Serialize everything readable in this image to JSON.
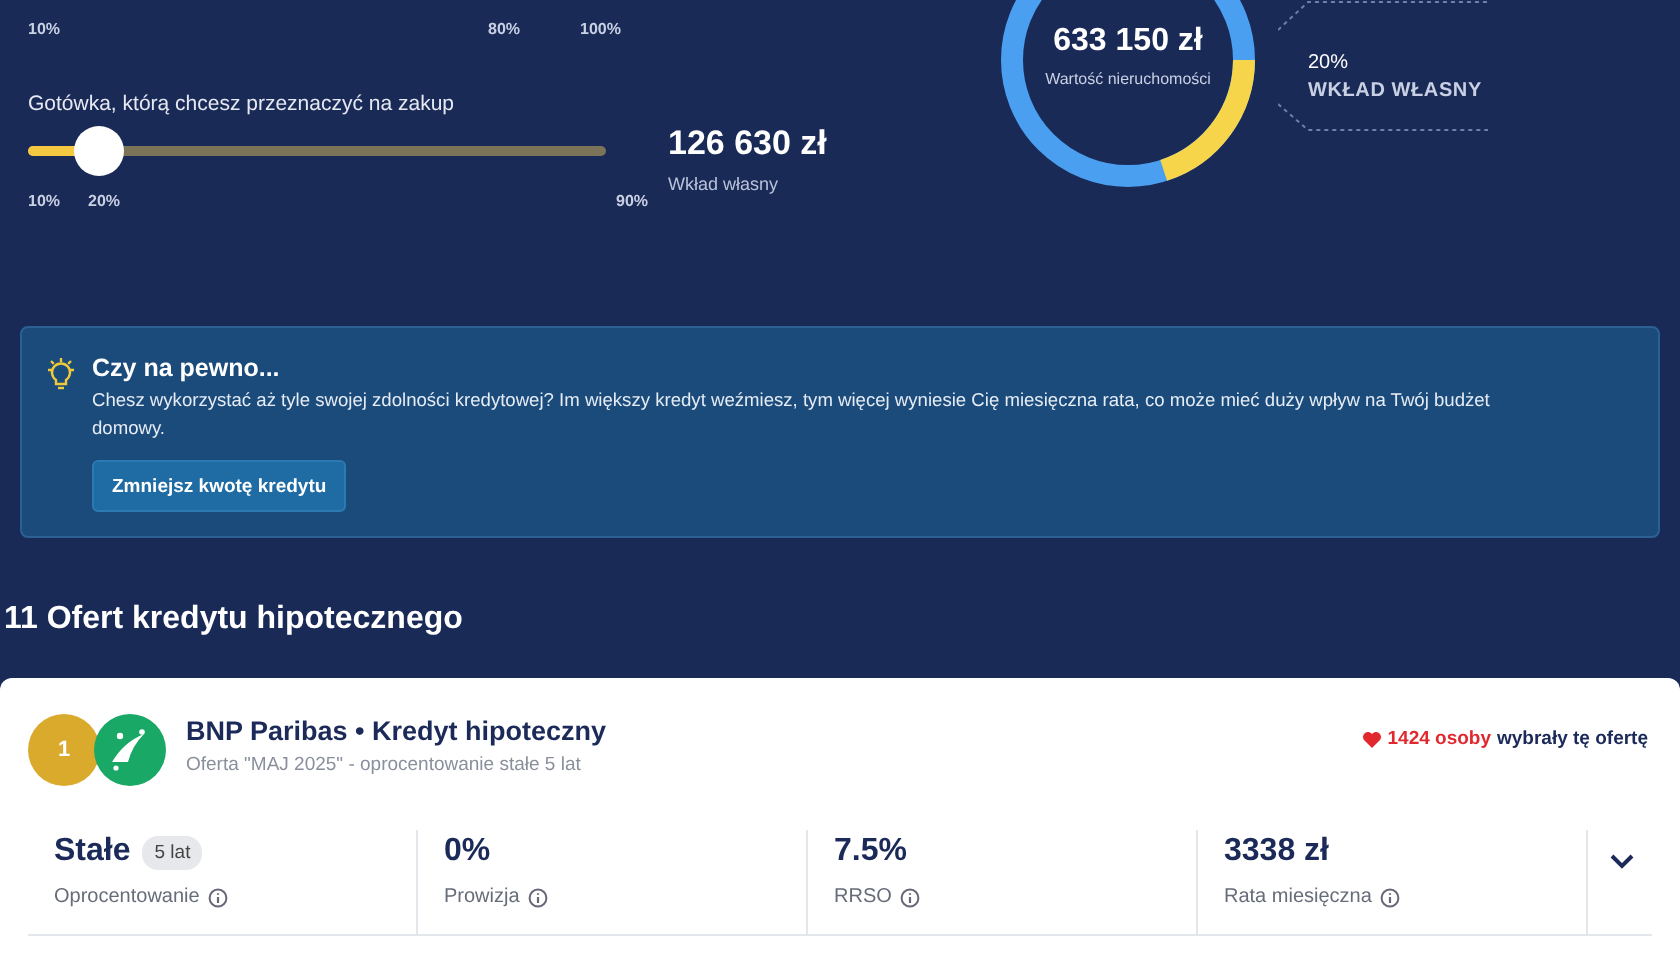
{
  "down_payment_top_ticks": [
    "10%",
    "80%",
    "100%"
  ],
  "cash_slider": {
    "label": "Gotówka, którą chcesz przeznaczyć na zakup",
    "level": 0.125,
    "ticks": [
      "10%",
      "20%",
      "90%"
    ],
    "value": "126 630 zł",
    "value_label": "Wkład własny"
  },
  "donut": {
    "value": "633 150 zł",
    "caption": "Wartość nieruchomości",
    "level": 0.2,
    "percent": "20%",
    "legend": "WKŁAD WŁASNY"
  },
  "alert": {
    "title": "Czy na pewno...",
    "text": "Chesz wykorzystać aż tyle swojej zdolności kredytowej? Im większy kredyt weźmiesz, tym więcej wyniesie Cię miesięczna rata, co może mieć duży wpływ na Twój budżet domowy.",
    "button": "Zmniejsz kwotę kredytu"
  },
  "offers_heading": "11 Ofert kredytu hipotecznego",
  "offer": {
    "rank": "1",
    "title": "BNP Paribas • Kredyt hipoteczny",
    "subtitle": "Oferta \"MAJ 2025\" - oprocentowanie stałe 5 lat",
    "popularity_count": "1424 osoby",
    "popularity_text": "wybrały tę ofertę",
    "expanded": false,
    "metrics": [
      {
        "value": "Stałe",
        "tag": "5 lat",
        "label": "Oprocentowanie"
      },
      {
        "value": "0%",
        "label": "Prowizja"
      },
      {
        "value": "7.5%",
        "label": "RRSO"
      },
      {
        "value": "3338 zł",
        "label": "Rata miesięczna"
      }
    ]
  }
}
